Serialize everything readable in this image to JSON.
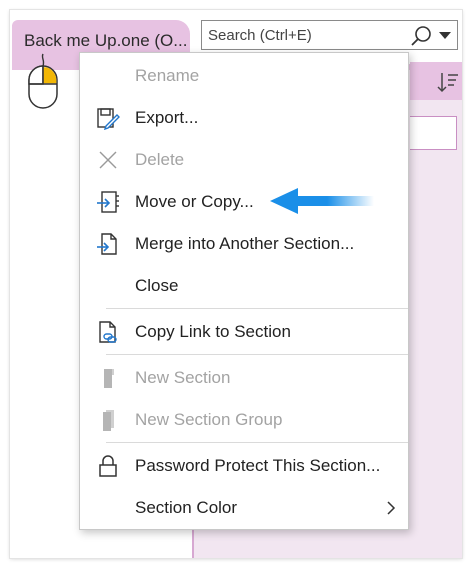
{
  "section_tab": {
    "label": "Back me Up.one (O..."
  },
  "search": {
    "placeholder": "Search (Ctrl+E)"
  },
  "menu": {
    "items": [
      {
        "label": "Rename",
        "icon": "none",
        "enabled": false
      },
      {
        "label": "Export...",
        "icon": "export-icon",
        "enabled": true
      },
      {
        "label": "Delete",
        "icon": "delete-x-icon",
        "enabled": false
      },
      {
        "label": "Move or Copy...",
        "icon": "move-copy-icon",
        "enabled": true
      },
      {
        "label": "Merge into Another Section...",
        "icon": "merge-icon",
        "enabled": true
      },
      {
        "label": "Close",
        "icon": "none",
        "enabled": true
      },
      {
        "label": "Copy Link to Section",
        "icon": "copy-link-icon",
        "enabled": true
      },
      {
        "label": "New Section",
        "icon": "new-section-icon",
        "enabled": false
      },
      {
        "label": "New Section Group",
        "icon": "new-section-group-icon",
        "enabled": false
      },
      {
        "label": "Password Protect This Section...",
        "icon": "lock-icon",
        "enabled": true
      },
      {
        "label": "Section Color",
        "icon": "none",
        "enabled": true,
        "has_submenu": true
      }
    ]
  },
  "colors": {
    "section_tab": "#e7c2e2",
    "page_pane": "#f2e6f1",
    "accent_arrow": "#1a8fe8",
    "mouse_button": "#f2b705"
  }
}
